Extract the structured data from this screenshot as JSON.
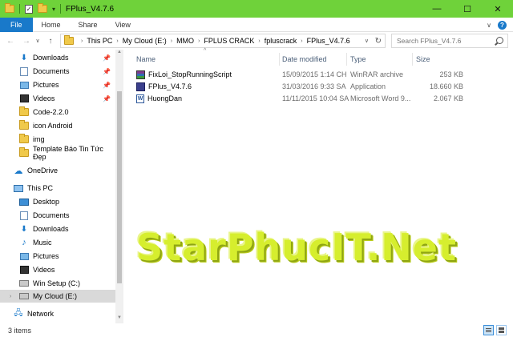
{
  "window": {
    "title": "FPlus_V4.7.6",
    "controls": {
      "minimize": "—",
      "maximize": "☐",
      "close": "✕"
    }
  },
  "qat": {
    "dropdown": "▾"
  },
  "ribbon": {
    "tabs": [
      "File",
      "Home",
      "Share",
      "View"
    ],
    "collapse": "∨",
    "help": "?"
  },
  "nav": {
    "back": "←",
    "forward": "→",
    "recent": "∨",
    "up": "↑",
    "breadcrumb": [
      "This PC",
      "My Cloud (E:)",
      "MMO",
      "FPLUS CRACK",
      "fpluscrack",
      "FPlus_V4.7.6"
    ],
    "separator": "›",
    "dropdown": "∨",
    "refresh": "↻"
  },
  "search": {
    "placeholder": "Search FPlus_V4.7.6"
  },
  "sidebar": {
    "quick_access": [
      {
        "label": "Downloads",
        "icon": "download-icon",
        "pinned": true
      },
      {
        "label": "Documents",
        "icon": "documents-icon",
        "pinned": true
      },
      {
        "label": "Pictures",
        "icon": "pictures-icon",
        "pinned": true
      },
      {
        "label": "Videos",
        "icon": "videos-icon",
        "pinned": true
      },
      {
        "label": "Code-2.2.0",
        "icon": "folder-icon",
        "pinned": false
      },
      {
        "label": "icon Android",
        "icon": "folder-icon",
        "pinned": false
      },
      {
        "label": "img",
        "icon": "folder-icon",
        "pinned": false
      },
      {
        "label": "Template Báo Tin Tức Đẹp",
        "icon": "folder-icon",
        "pinned": false
      }
    ],
    "onedrive": "OneDrive",
    "this_pc": "This PC",
    "pc_items": [
      {
        "label": "Desktop",
        "icon": "desktop-icon"
      },
      {
        "label": "Documents",
        "icon": "documents-icon"
      },
      {
        "label": "Downloads",
        "icon": "download-icon"
      },
      {
        "label": "Music",
        "icon": "music-icon"
      },
      {
        "label": "Pictures",
        "icon": "pictures-icon"
      },
      {
        "label": "Videos",
        "icon": "videos-icon"
      },
      {
        "label": "Win Setup (C:)",
        "icon": "drive-icon"
      },
      {
        "label": "My Cloud (E:)",
        "icon": "drive-icon"
      }
    ],
    "network": "Network",
    "pin_glyph": "📌",
    "expand_glyph": "›",
    "selected": "My Cloud (E:)"
  },
  "files": {
    "columns": {
      "name": "Name",
      "date": "Date modified",
      "type": "Type",
      "size": "Size"
    },
    "rows": [
      {
        "name": "FixLoi_StopRunningScript",
        "date": "15/09/2015 1:14 CH",
        "type": "WinRAR archive",
        "size": "253 KB",
        "icon": "winrar-icon"
      },
      {
        "name": "FPlus_V4.7.6",
        "date": "31/03/2016 9:33 SA",
        "type": "Application",
        "size": "18.660 KB",
        "icon": "application-icon"
      },
      {
        "name": "HuongDan",
        "date": "11/11/2015 10:04 SA",
        "type": "Microsoft Word 9...",
        "size": "2.067 KB",
        "icon": "word-doc-icon"
      }
    ]
  },
  "watermark": "StarPhucIT.Net",
  "status": {
    "item_count": "3 items"
  },
  "colors": {
    "titlebar": "#6fd23a",
    "file_tab": "#1979ca",
    "selected": "#d9d9d9",
    "watermark": "#d6ee2e"
  }
}
